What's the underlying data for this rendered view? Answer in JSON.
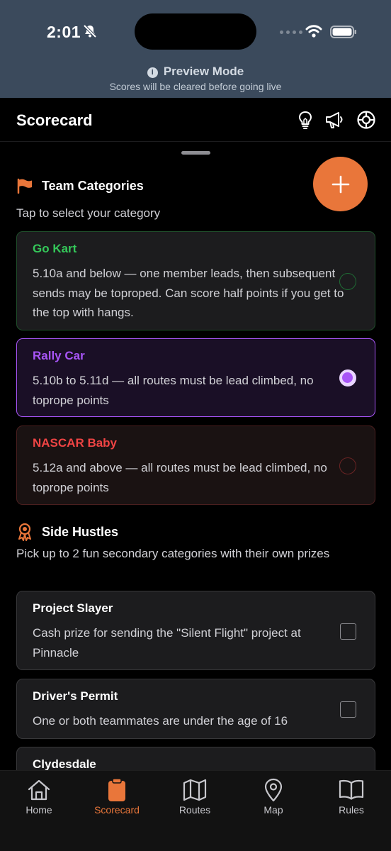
{
  "status_bar": {
    "time": "2:01"
  },
  "preview": {
    "title": "Preview Mode",
    "subtitle": "Scores will be cleared before going live"
  },
  "header": {
    "title": "Scorecard",
    "icons": [
      "lightbulb-icon",
      "megaphone-icon",
      "lifebuoy-icon"
    ]
  },
  "team_categories": {
    "title": "Team Categories",
    "subtitle": "Tap to select your category",
    "items": [
      {
        "name": "Go Kart",
        "description": "5.10a and below — one member leads, then subsequent sends may be toproped. Can score half points if you get to the top with hangs.",
        "color": "#34c759",
        "selected": false
      },
      {
        "name": "Rally Car",
        "description": "5.10b to 5.11d — all routes must be lead climbed, no toprope points",
        "color": "#a855f7",
        "selected": true
      },
      {
        "name": "NASCAR Baby",
        "description": "5.12a and above — all routes must be lead climbed, no toprope points",
        "color": "#ef4444",
        "selected": false
      }
    ]
  },
  "side_hustles": {
    "title": "Side Hustles",
    "subtitle": "Pick up to 2 fun secondary categories with their own prizes",
    "items": [
      {
        "name": "Project Slayer",
        "description": "Cash prize for sending the \"Silent Flight\" project at Pinnacle",
        "checked": false
      },
      {
        "name": "Driver's Permit",
        "description": "One or both teammates are under the age of 16",
        "checked": false
      },
      {
        "name": "Clydesdale",
        "description": "",
        "checked": false
      }
    ]
  },
  "tabs": [
    {
      "label": "Home",
      "icon": "home-icon",
      "active": false
    },
    {
      "label": "Scorecard",
      "icon": "clipboard-icon",
      "active": true
    },
    {
      "label": "Routes",
      "icon": "map-folded-icon",
      "active": false
    },
    {
      "label": "Map",
      "icon": "map-pin-icon",
      "active": false
    },
    {
      "label": "Rules",
      "icon": "book-icon",
      "active": false
    }
  ],
  "colors": {
    "accent": "#e9763a",
    "banner": "#3b4a5c",
    "go_kart": "#34c759",
    "rally_car": "#a855f7",
    "nascar": "#ef4444"
  }
}
